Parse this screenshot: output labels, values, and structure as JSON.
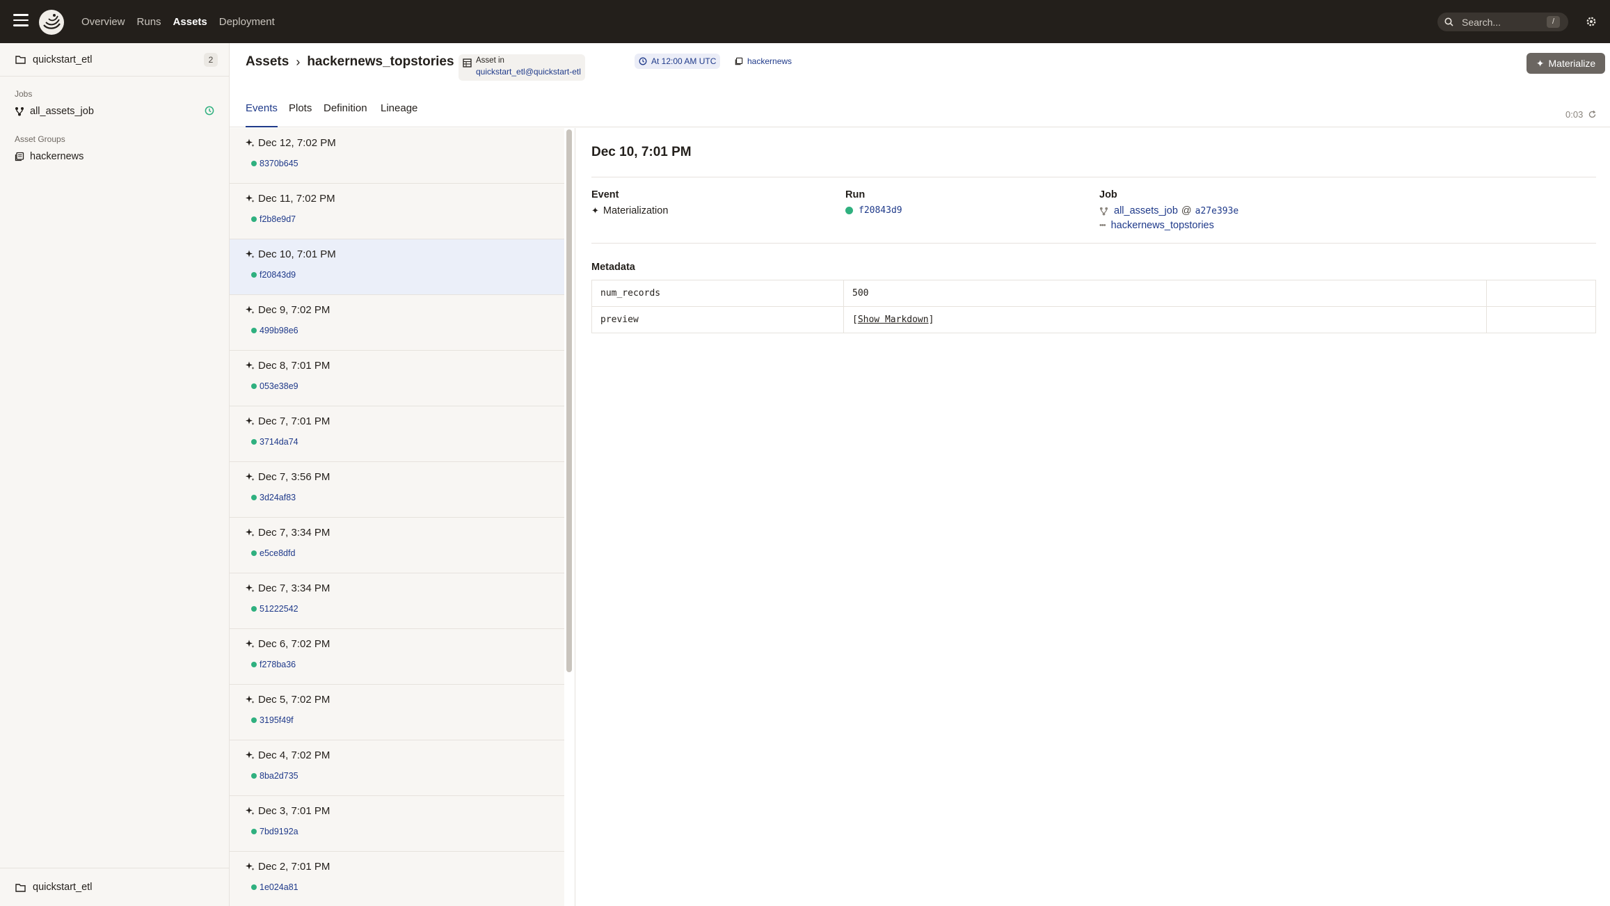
{
  "nav": {
    "links": [
      "Overview",
      "Runs",
      "Assets",
      "Deployment"
    ],
    "active": "Assets",
    "search_placeholder": "Search...",
    "search_shortcut": "/"
  },
  "sidebar": {
    "repo_name": "quickstart_etl",
    "repo_count": "2",
    "jobs_label": "Jobs",
    "job_name": "all_assets_job",
    "groups_label": "Asset Groups",
    "group_name": "hackernews",
    "footer_repo": "quickstart_etl"
  },
  "header": {
    "breadcrumb_root": "Assets",
    "asset_name": "hackernews_topstories",
    "asset_in_label": "Asset in",
    "asset_in_location": "quickstart_etl@quickstart-etl",
    "schedule": "At 12:00 AM UTC",
    "group": "hackernews",
    "materialize_label": "Materialize"
  },
  "tabs": {
    "items": [
      "Events",
      "Plots",
      "Definition",
      "Lineage"
    ],
    "active": "Events",
    "timer": "0:03"
  },
  "events": [
    {
      "date": "Dec 12, 7:02 PM",
      "run": "8370b645"
    },
    {
      "date": "Dec 11, 7:02 PM",
      "run": "f2b8e9d7"
    },
    {
      "date": "Dec 10, 7:01 PM",
      "run": "f20843d9"
    },
    {
      "date": "Dec 9, 7:02 PM",
      "run": "499b98e6"
    },
    {
      "date": "Dec 8, 7:01 PM",
      "run": "053e38e9"
    },
    {
      "date": "Dec 7, 7:01 PM",
      "run": "3714da74"
    },
    {
      "date": "Dec 7, 3:56 PM",
      "run": "3d24af83"
    },
    {
      "date": "Dec 7, 3:34 PM",
      "run": "e5ce8dfd"
    },
    {
      "date": "Dec 7, 3:34 PM",
      "run": "51222542"
    },
    {
      "date": "Dec 6, 7:02 PM",
      "run": "f278ba36"
    },
    {
      "date": "Dec 5, 7:02 PM",
      "run": "3195f49f"
    },
    {
      "date": "Dec 4, 7:02 PM",
      "run": "8ba2d735"
    },
    {
      "date": "Dec 3, 7:01 PM",
      "run": "7bd9192a"
    },
    {
      "date": "Dec 2, 7:01 PM",
      "run": "1e024a81"
    }
  ],
  "selected_event_index": 2,
  "detail": {
    "title": "Dec 10, 7:01 PM",
    "event_label": "Event",
    "event_value": "Materialization",
    "run_label": "Run",
    "run_value": "f20843d9",
    "job_label": "Job",
    "job_name": "all_assets_job",
    "job_at": "@",
    "job_snapshot": "a27e393e",
    "job_op": "hackernews_topstories",
    "metadata_label": "Metadata",
    "metadata": [
      {
        "key": "num_records",
        "value": "500"
      },
      {
        "key": "preview",
        "value_prefix": "[",
        "value_link": "Show Markdown",
        "value_suffix": "]"
      }
    ]
  },
  "colors": {
    "topbar": "#231f1b",
    "accent": "#1f3a8a",
    "success": "#2fb07f",
    "selected_row": "#ebeff9"
  }
}
